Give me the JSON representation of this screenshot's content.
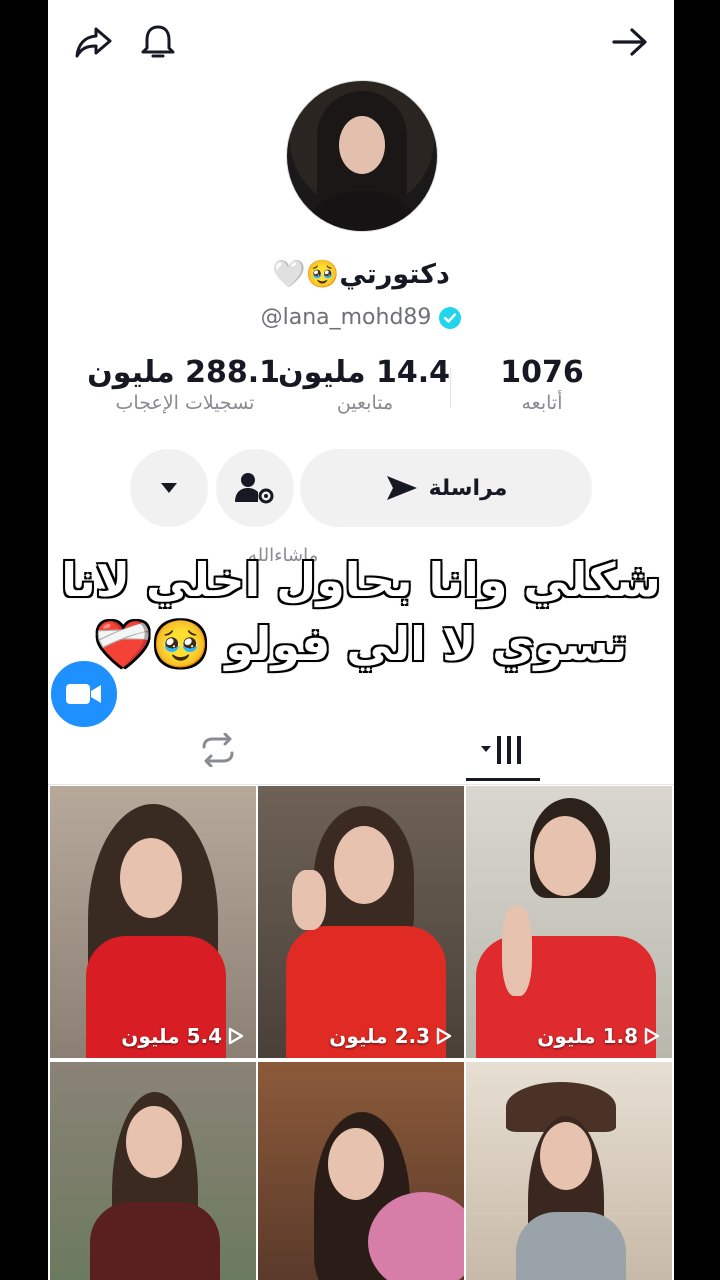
{
  "profile": {
    "display_name": "دكتورتي🥹🤍",
    "handle": "@lana_mohd89",
    "bio_partial": "ماشاءالله"
  },
  "stats": {
    "following_count": "1076",
    "following_label": "أتابعه",
    "followers_count": "14.4 مليون",
    "followers_label": "متابعين",
    "likes_count": "288.1 مليون",
    "likes_label": "تسجيلات الإعجاب"
  },
  "actions": {
    "message_label": "مراسلة"
  },
  "overlay": {
    "line1": "شكلي وانا بحاول اخلي لانا",
    "line2": "تسوي لا الي فولو 🥹❤️‍🩹"
  },
  "videos": [
    {
      "views": "5.4 مليون"
    },
    {
      "views": "2.3 مليون"
    },
    {
      "views": "1.8 مليون"
    },
    {
      "views": ""
    },
    {
      "views": ""
    },
    {
      "views": ""
    }
  ],
  "icons": [
    "share-icon",
    "bell-icon",
    "arrow-right-icon",
    "verified-icon",
    "send-icon",
    "add-friend-settings-icon",
    "dropdown-icon",
    "video-call-icon",
    "repost-tab-icon",
    "videos-grid-tab-icon",
    "play-icon"
  ],
  "colors": {
    "verified": "#20d5ec",
    "fab": "#1e90ff",
    "button_bg": "#f1f1f2",
    "text_primary": "#161823"
  }
}
